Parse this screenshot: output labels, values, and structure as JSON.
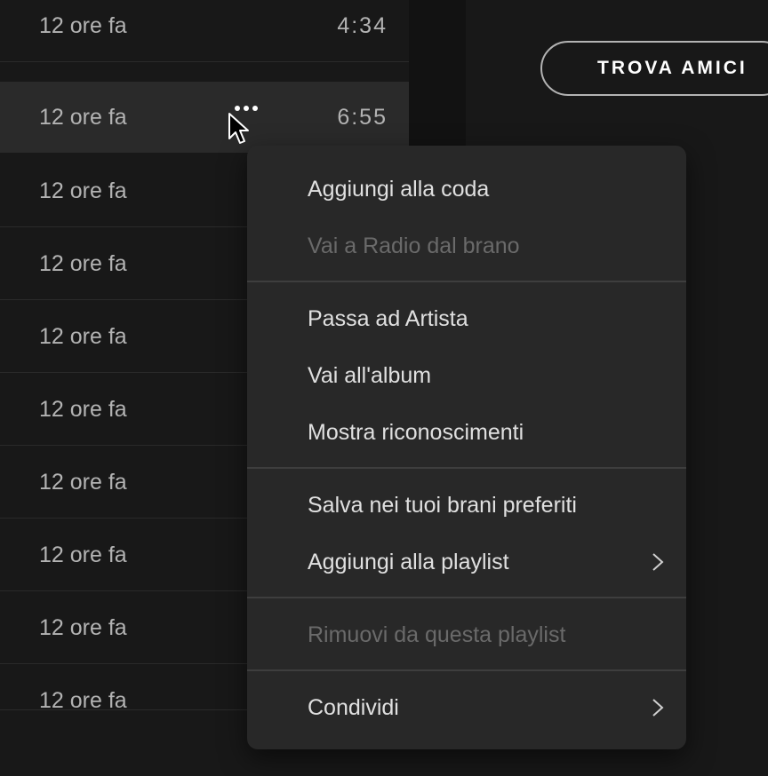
{
  "rows": [
    {
      "added": "12 ore fa",
      "duration": "4:34"
    },
    {
      "added": "12 ore fa",
      "duration": "6:55"
    },
    {
      "added": "12 ore fa"
    },
    {
      "added": "12 ore fa"
    },
    {
      "added": "12 ore fa"
    },
    {
      "added": "12 ore fa"
    },
    {
      "added": "12 ore fa"
    },
    {
      "added": "12 ore fa"
    },
    {
      "added": "12 ore fa"
    },
    {
      "added": "12 ore fa"
    }
  ],
  "friends_button": "TROVA AMICI",
  "context_menu": {
    "add_to_queue": "Aggiungi alla coda",
    "go_to_radio": "Vai a Radio dal brano",
    "go_to_artist": "Passa ad Artista",
    "go_to_album": "Vai all'album",
    "show_credits": "Mostra riconoscimenti",
    "save_liked": "Salva nei tuoi brani preferiti",
    "add_to_playlist": "Aggiungi alla playlist",
    "remove_from_playlist": "Rimuovi da questa playlist",
    "share": "Condividi"
  },
  "icons": {
    "more": "more-options-icon",
    "chevron": "chevron-right-icon",
    "cursor": "mouse-pointer-icon"
  }
}
